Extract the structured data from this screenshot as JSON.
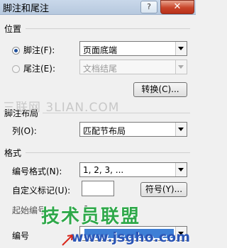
{
  "window": {
    "title": "脚注和尾注",
    "help_label": "?",
    "close_label": "✕"
  },
  "position": {
    "heading": "位置",
    "footnote_label": "脚注(F):",
    "footnote_value": "页面底端",
    "endnote_label": "尾注(E):",
    "endnote_value": "文档结尾",
    "convert_button": "转换(C)..."
  },
  "layout": {
    "heading": "脚注布局",
    "columns_label": "列(O):",
    "columns_value": "匹配节布局"
  },
  "format": {
    "heading": "格式",
    "number_format_label": "编号格式(N):",
    "number_format_value": "1, 2, 3, ...",
    "custom_mark_label": "自定义标记(U):",
    "custom_mark_value": "",
    "symbol_button": "符号(Y)...",
    "start_at_label": "起始编号",
    "start_at_value": "1",
    "numbering_label": "编号"
  },
  "watermarks": {
    "top": "三联网 3LIAN.COM",
    "middle": "技术员联盟",
    "bottom": "www.jsgho.com"
  },
  "colors": {
    "title_bar": "#b6c8de",
    "close_button": "#c8452a",
    "watermark_green": "#2fa84a",
    "watermark_blue": "#2b55b5",
    "numbering_select": "#3e7fd6"
  },
  "icons": {
    "radio_checked": "radio-checked",
    "radio_unchecked": "radio-unchecked",
    "dropdown": "chevron-down",
    "arrow": "red-arrow"
  }
}
